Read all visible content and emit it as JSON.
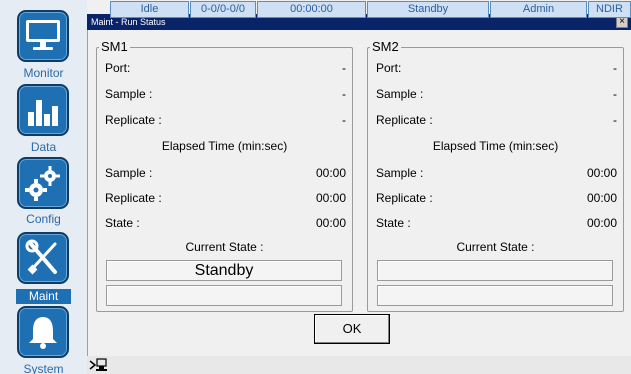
{
  "nav": {
    "items": [
      {
        "label": "Monitor",
        "icon": "monitor-icon"
      },
      {
        "label": "Data",
        "icon": "bar-chart-icon"
      },
      {
        "label": "Config",
        "icon": "gears-icon"
      },
      {
        "label": "Maint",
        "icon": "tools-icon",
        "active": true
      },
      {
        "label": "System",
        "icon": "bell-icon"
      }
    ]
  },
  "dialog": {
    "title": "Maint - Run Status",
    "close_label": "×",
    "ok_label": "OK"
  },
  "panels": [
    {
      "title": "SM1",
      "port_label": "Port:",
      "port_value": "-",
      "sample_label": "Sample :",
      "sample_value": "-",
      "replicate_label": "Replicate :",
      "replicate_value": "-",
      "elapsed_heading": "Elapsed Time (min:sec)",
      "et_sample_label": "Sample :",
      "et_sample_value": "00:00",
      "et_replicate_label": "Replicate :",
      "et_replicate_value": "00:00",
      "state_label": "State :",
      "state_value": "00:00",
      "current_state_heading": "Current State :",
      "current_state": "Standby",
      "secondary_state": ""
    },
    {
      "title": "SM2",
      "port_label": "Port:",
      "port_value": "-",
      "sample_label": "Sample :",
      "sample_value": "-",
      "replicate_label": "Replicate :",
      "replicate_value": "-",
      "elapsed_heading": "Elapsed Time (min:sec)",
      "et_sample_label": "Sample :",
      "et_sample_value": "00:00",
      "et_replicate_label": "Replicate :",
      "et_replicate_value": "00:00",
      "state_label": "State :",
      "state_value": "00:00",
      "current_state_heading": "Current State :",
      "current_state": "",
      "secondary_state": ""
    }
  ],
  "statusbar": {
    "cells": [
      "Idle",
      "0-0/0-0/0",
      "00:00:00",
      "Standby",
      "Admin",
      "NDIR"
    ]
  },
  "colors": {
    "nav_button": "#1f6fb3",
    "nav_label": "#2b6aa8",
    "titlebar": "#0a246a",
    "status_cell": "#cfe0f5"
  }
}
